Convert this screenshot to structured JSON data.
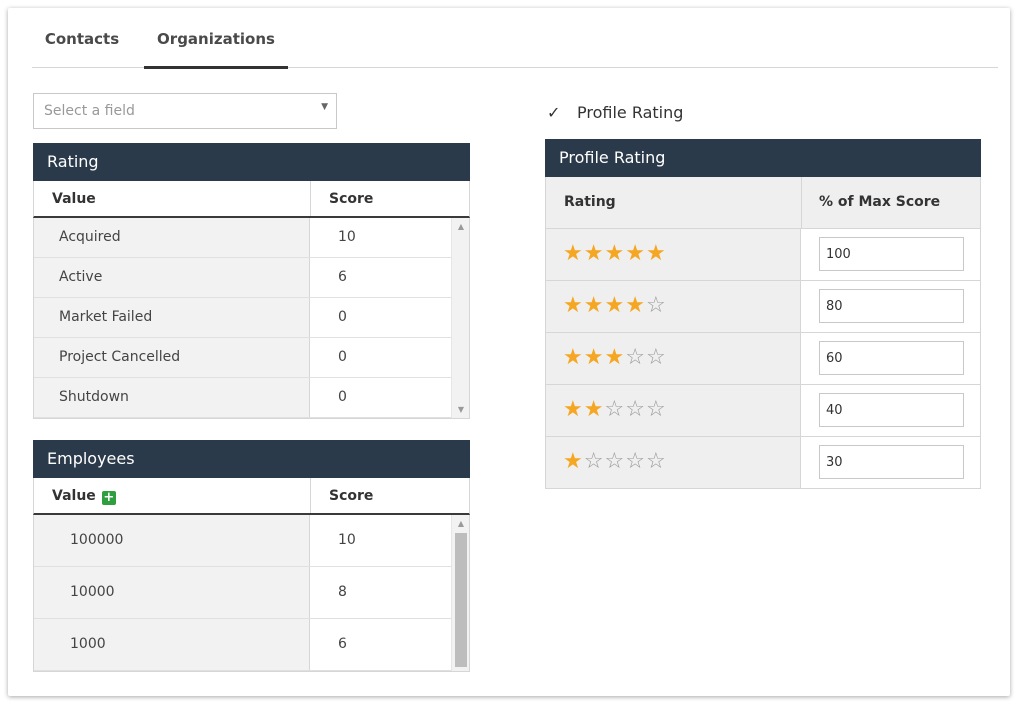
{
  "tabs": [
    {
      "label": "Contacts",
      "active": false
    },
    {
      "label": "Organizations",
      "active": true
    }
  ],
  "field_select": {
    "placeholder": "Select a field",
    "caret": "▼"
  },
  "profile_rating_toggle": {
    "label": "Profile Rating",
    "checked": true,
    "check_glyph": "✓"
  },
  "rating_table": {
    "title": "Rating",
    "columns": [
      "Value",
      "Score"
    ],
    "rows": [
      {
        "value": "Acquired",
        "score": "10"
      },
      {
        "value": "Active",
        "score": "6"
      },
      {
        "value": "Market Failed",
        "score": "0"
      },
      {
        "value": "Project Cancelled",
        "score": "0"
      },
      {
        "value": "Shutdown",
        "score": "0"
      }
    ]
  },
  "employees_table": {
    "title": "Employees",
    "columns": [
      "Value",
      "Score"
    ],
    "add_icon": "+",
    "rows": [
      {
        "value": "100000",
        "score": "10"
      },
      {
        "value": "10000",
        "score": "8"
      },
      {
        "value": "1000",
        "score": "6"
      }
    ]
  },
  "profile_rating_table": {
    "title": "Profile Rating",
    "columns": [
      "Rating",
      "% of Max Score"
    ],
    "rows": [
      {
        "stars_filled": 5,
        "stars_empty": 0,
        "percent": "100"
      },
      {
        "stars_filled": 4,
        "stars_empty": 1,
        "percent": "80"
      },
      {
        "stars_filled": 3,
        "stars_empty": 2,
        "percent": "60"
      },
      {
        "stars_filled": 2,
        "stars_empty": 3,
        "percent": "40"
      },
      {
        "stars_filled": 1,
        "stars_empty": 4,
        "percent": "30"
      }
    ]
  },
  "scroll_arrows": {
    "up": "▲",
    "down": "▼"
  },
  "colors": {
    "header_bg": "#2b3a4a",
    "star": "#f5a623",
    "add_icon": "#2e9e3e"
  }
}
